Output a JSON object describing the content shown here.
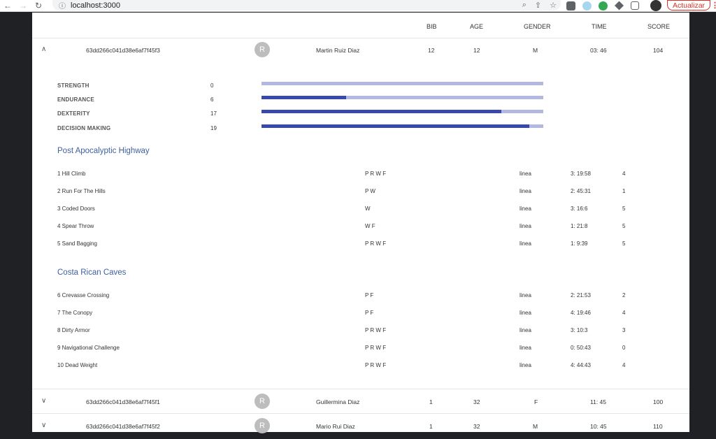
{
  "browser": {
    "back_icon": "←",
    "forward_icon": "→",
    "reload_icon": "↻",
    "info_icon": "ⓘ",
    "url": "localhost:3000",
    "zoom_icon": "⌕",
    "share_icon": "⇪",
    "star_icon": "☆",
    "update_label": "Actualizar",
    "menu_icon": "⋮"
  },
  "table": {
    "headers": {
      "bib": "BIB",
      "age": "AGE",
      "gender": "GENDER",
      "time": "TIME",
      "score": "SCORE"
    },
    "expanded_row": {
      "chevron": "∧",
      "id": "63dd266c041d38e6af7f45f3",
      "avatar": "R",
      "name": "Martin Ruiz Diaz",
      "bib": "12",
      "age": "12",
      "gender": "M",
      "time": "03: 46",
      "score": "104"
    },
    "stats": [
      {
        "label": "STRENGTH",
        "value": "0",
        "fill": 0
      },
      {
        "label": "ENDURANCE",
        "value": "6",
        "fill": 0.3
      },
      {
        "label": "DEXTERITY",
        "value": "17",
        "fill": 0.85
      },
      {
        "label": "DECISION MAKING",
        "value": "19",
        "fill": 0.95
      }
    ],
    "sections": [
      {
        "title": "Post Apocalyptic Highway",
        "tasks": [
          {
            "name": "1 Hill Climb",
            "flags": "P R W F",
            "type": "linea",
            "time": "3: 19:58",
            "score": "4"
          },
          {
            "name": "2 Run For The Hills",
            "flags": "P W",
            "type": "linea",
            "time": "2: 45:31",
            "score": "1"
          },
          {
            "name": "3 Coded Doors",
            "flags": "W",
            "type": "linea",
            "time": "3: 16:6",
            "score": "5"
          },
          {
            "name": "4 Spear Throw",
            "flags": "W F",
            "type": "linea",
            "time": "1: 21:8",
            "score": "5"
          },
          {
            "name": "5 Sand Bagging",
            "flags": "P R W F",
            "type": "linea",
            "time": "1: 9:39",
            "score": "5"
          }
        ]
      },
      {
        "title": "Costa Rican Caves",
        "tasks": [
          {
            "name": "6 Crevasse Crossing",
            "flags": "P F",
            "type": "linea",
            "time": "2: 21:53",
            "score": "2"
          },
          {
            "name": "7 The Conopy",
            "flags": "P F",
            "type": "linea",
            "time": "4: 19:46",
            "score": "4"
          },
          {
            "name": "8 Dirty Armor",
            "flags": "P R W F",
            "type": "linea",
            "time": "3: 10:3",
            "score": "3"
          },
          {
            "name": "9 Navigational Challenge",
            "flags": "P R W F",
            "type": "linea",
            "time": "0: 50:43",
            "score": "0"
          },
          {
            "name": "10 Dead Weight",
            "flags": "P R W F",
            "type": "linea",
            "time": "4: 44:43",
            "score": "4"
          }
        ]
      }
    ],
    "rows": [
      {
        "chevron": "∨",
        "id": "63dd266c041d38e6af7f45f1",
        "avatar": "R",
        "name": "Guillermina Diaz",
        "bib": "1",
        "age": "32",
        "gender": "F",
        "time": "11: 45",
        "score": "100"
      },
      {
        "chevron": "∨",
        "id": "63dd266c041d38e6af7f45f2",
        "avatar": "R",
        "name": "Mario Rui Diaz",
        "bib": "1",
        "age": "32",
        "gender": "M",
        "time": "10: 45",
        "score": "110"
      }
    ]
  }
}
